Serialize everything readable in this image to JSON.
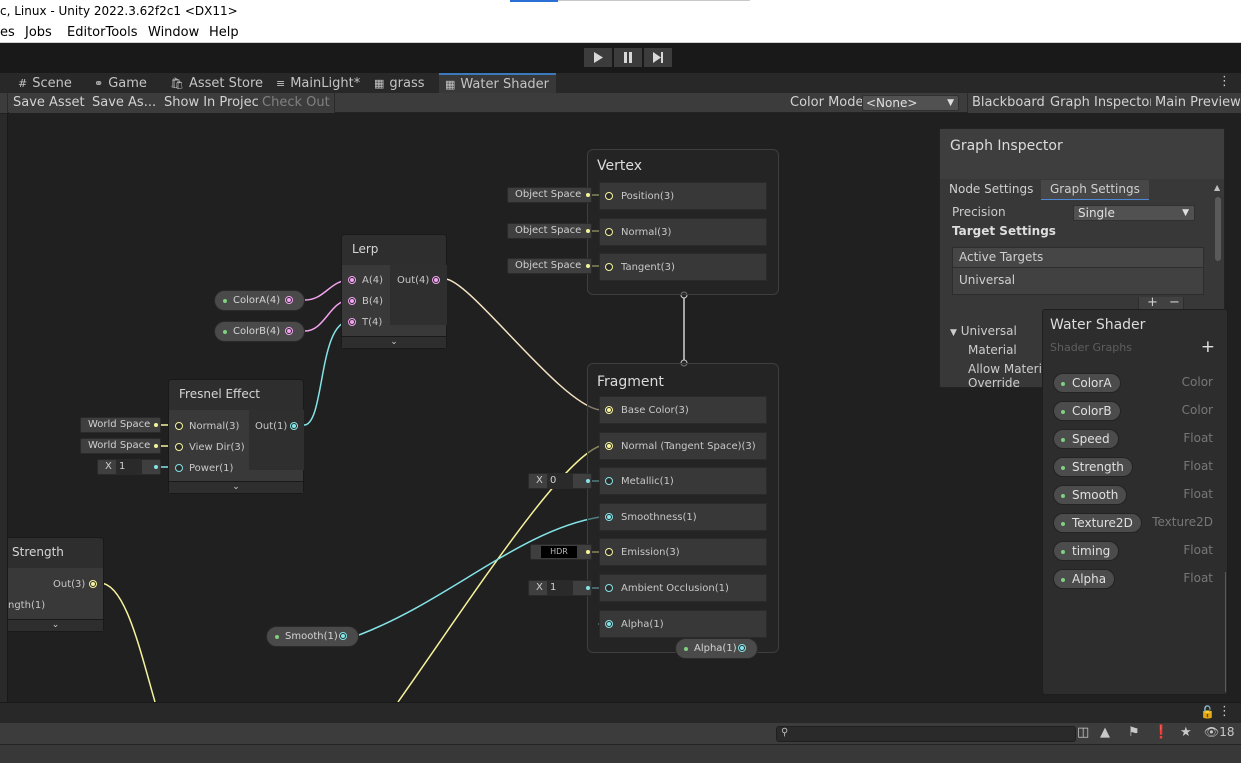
{
  "window": {
    "title": "c, Linux - Unity 2022.3.62f2c1 <DX11>"
  },
  "menu": [
    "es",
    "Jobs",
    "EditorTools",
    "Window",
    "Help"
  ],
  "tabs": [
    {
      "label": "Scene",
      "icon": "scene-icon"
    },
    {
      "label": "Game",
      "icon": "game-icon"
    },
    {
      "label": "Asset Store",
      "icon": "asset-store-icon"
    },
    {
      "label": "MainLight*",
      "icon": "hierarchy-icon"
    },
    {
      "label": "grass",
      "icon": "shader-graph-icon"
    },
    {
      "label": "Water Shader",
      "icon": "shader-graph-icon"
    }
  ],
  "graph_toolbar": {
    "save_asset": "Save Asset",
    "save_as": "Save As...",
    "show_in_project": "Show In Project",
    "check_out": "Check Out",
    "color_mode_label": "Color Mode",
    "color_mode_value": "<None>",
    "blackboard": "Blackboard",
    "graph_inspector": "Graph Inspector",
    "main_preview": "Main Preview"
  },
  "nodes": {
    "lerp": {
      "title": "Lerp",
      "in": [
        "A(4)",
        "B(4)",
        "T(4)"
      ],
      "out": "Out(4)"
    },
    "fresnel": {
      "title": "Fresnel Effect",
      "in": [
        "Normal(3)",
        "View Dir(3)",
        "Power(1)"
      ],
      "out": "Out(1)",
      "inputs": [
        "World Space",
        "World Space"
      ],
      "power_axis": "X",
      "power_value": "1"
    },
    "strength": {
      "title": "Strength",
      "out": "Out(3)",
      "partial_in": "ngth(1)"
    },
    "vertex": {
      "title": "Vertex",
      "ports": [
        "Position(3)",
        "Normal(3)",
        "Tangent(3)"
      ],
      "inputs": [
        "Object Space",
        "Object Space",
        "Object Space"
      ]
    },
    "fragment": {
      "title": "Fragment",
      "ports": [
        "Base Color(3)",
        "Normal (Tangent Space)(3)",
        "Metallic(1)",
        "Smoothness(1)",
        "Emission(3)",
        "Ambient Occlusion(1)",
        "Alpha(1)"
      ],
      "metallic_axis": "X",
      "metallic_value": "0",
      "emission_label": "HDR",
      "ao_axis": "X",
      "ao_value": "1"
    }
  },
  "property_nodes": {
    "colorA": "ColorA(4)",
    "colorB": "ColorB(4)",
    "smooth": "Smooth(1)",
    "alpha": "Alpha(1)"
  },
  "graph_inspector": {
    "title": "Graph Inspector",
    "tabs": [
      "Node Settings",
      "Graph Settings"
    ],
    "precision_label": "Precision",
    "precision_value": "Single",
    "target_settings": "Target Settings",
    "active_targets": "Active Targets",
    "active_target_item": "Universal",
    "universal_section": "Universal",
    "material_label": "Material",
    "allow_override_1": "Allow Materia",
    "allow_override_2": "Override"
  },
  "blackboard": {
    "title": "Water Shader",
    "subtitle": "Shader Graphs",
    "properties": [
      {
        "name": "ColorA",
        "type": "Color"
      },
      {
        "name": "ColorB",
        "type": "Color"
      },
      {
        "name": "Speed",
        "type": "Float"
      },
      {
        "name": "Strength",
        "type": "Float"
      },
      {
        "name": "Smooth",
        "type": "Float"
      },
      {
        "name": "Texture2D",
        "type": "Texture2D"
      },
      {
        "name": "timing",
        "type": "Float"
      },
      {
        "name": "Alpha",
        "type": "Float"
      }
    ]
  },
  "console": {
    "count": "18"
  },
  "colors": {
    "accent": "#3a79bb",
    "vec4": "#f3a3f0",
    "vec3": "#f6f39b",
    "vec1": "#84e4e7"
  }
}
